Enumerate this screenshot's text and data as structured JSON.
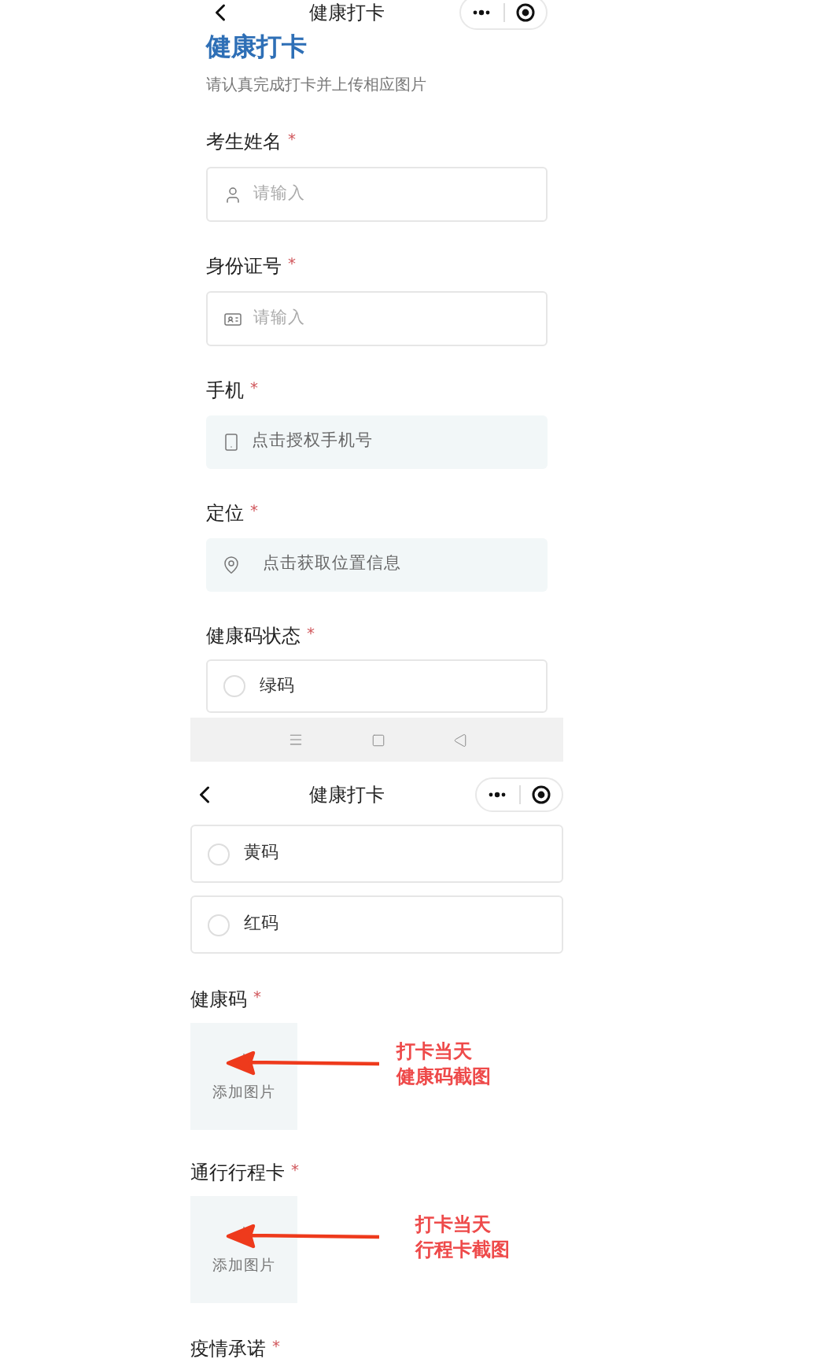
{
  "screen_1": {
    "nav": {
      "title": "健康打卡"
    },
    "heading": "健康打卡",
    "subtitle": "请认真完成打卡并上传相应图片",
    "fields": [
      {
        "label": "考生姓名",
        "mark": "*",
        "kind": "name",
        "placeholder": "请输入"
      },
      {
        "label": "身份证号",
        "mark": "*",
        "kind": "idcard",
        "placeholder": "请输入"
      },
      {
        "label": "手机",
        "mark": "*",
        "kind": "phone",
        "text": "点击授权手机号"
      },
      {
        "label": "定位",
        "mark": "*",
        "kind": "location",
        "text": "点击获取位置信息"
      }
    ],
    "radio_group": {
      "label": "健康码状态",
      "mark": "*",
      "options": [
        {
          "label": "绿码",
          "selected": false
        }
      ]
    }
  },
  "screen_2": {
    "nav": {
      "title": "健康打卡"
    },
    "options": [
      {
        "label": "黄码",
        "selected": false
      },
      {
        "label": "红码",
        "selected": false
      }
    ],
    "uploads": [
      {
        "label": "健康码",
        "mark": "*",
        "button": "添加图片",
        "note": [
          "打卡当天",
          "健康码截图"
        ]
      },
      {
        "label": "通行行程卡",
        "mark": "*",
        "button": "添加图片",
        "note": [
          "打卡当天",
          "行程卡截图"
        ]
      }
    ],
    "last_label": {
      "label": "疫情承诺",
      "mark": "*"
    }
  }
}
